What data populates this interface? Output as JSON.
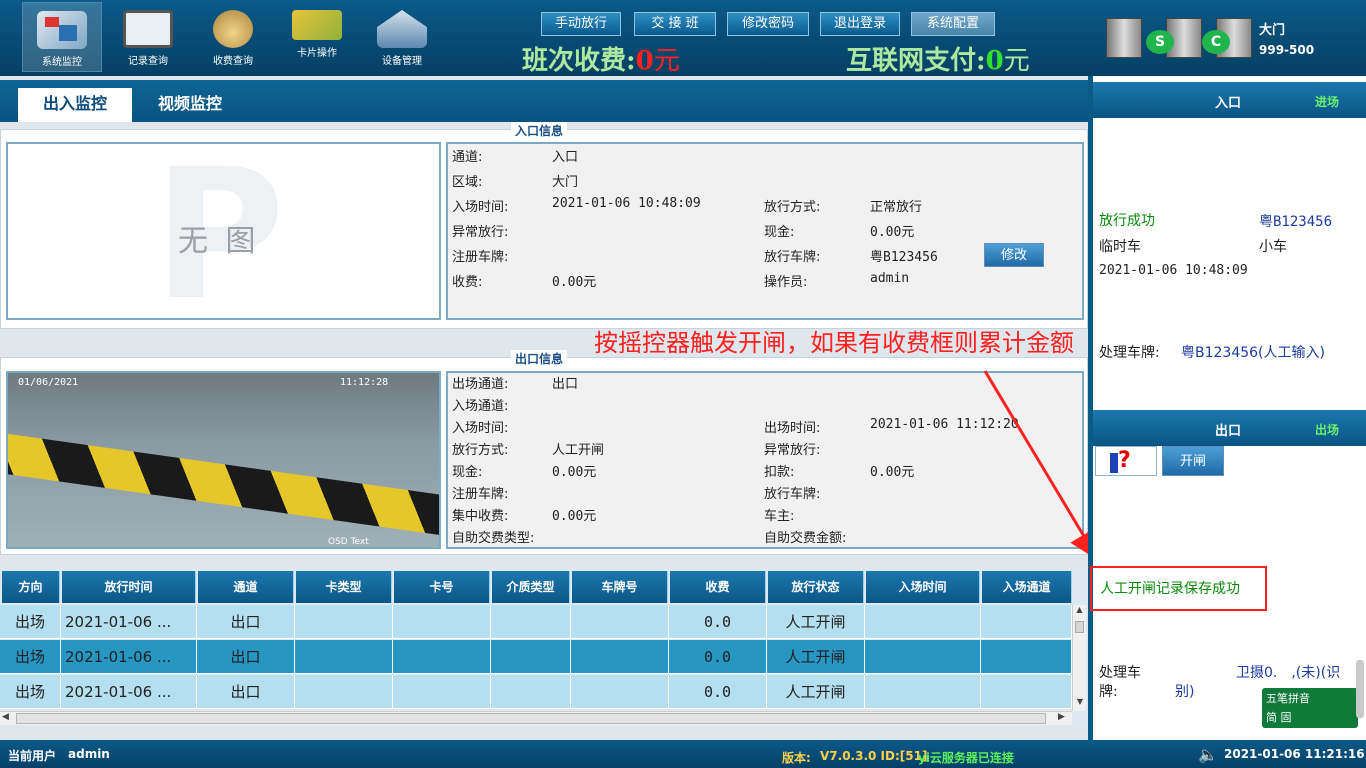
{
  "nav": [
    {
      "label": "系统监控",
      "active": true
    },
    {
      "label": "记录查询"
    },
    {
      "label": "收费查询"
    },
    {
      "label": "卡片操作"
    },
    {
      "label": "设备管理"
    }
  ],
  "top_buttons": [
    "手动放行",
    "交 接 班",
    "修改密码",
    "退出登录",
    "系统配置"
  ],
  "fee": {
    "shift_label": "班次收费:",
    "shift_value": "0",
    "shift_unit": "元",
    "net_label": "互联网支付:",
    "net_value": "0",
    "net_unit": "元"
  },
  "station": {
    "name": "大门",
    "code": "999-500"
  },
  "tabs": [
    "出入监控",
    "视频监控"
  ],
  "entry": {
    "section_title": "入口信息",
    "no_image": "无 图",
    "channel_label": "通道:",
    "channel": "入口",
    "area_label": "区域:",
    "area": "大门",
    "time_label": "入场时间:",
    "time": "2021-01-06 10:48:09",
    "release_mode_label": "放行方式:",
    "release_mode": "正常放行",
    "abnormal_label": "异常放行:",
    "cash_label": "现金:",
    "cash": "0.00元",
    "reg_plate_label": "注册车牌:",
    "release_plate_label": "放行车牌:",
    "release_plate": "粤B123456",
    "modify_button": "修改",
    "fee_label": "收费:",
    "fee": "0.00元",
    "operator_label": "操作员:",
    "operator": "admin"
  },
  "exit": {
    "section_title": "出口信息",
    "cam_date": "01/06/2021",
    "cam_time": "11:12:28",
    "cam_osd": "OSD Text",
    "out_channel_label": "出场通道:",
    "out_channel": "出口",
    "in_channel_label": "入场通道:",
    "in_time_label": "入场时间:",
    "out_time_label": "出场时间:",
    "out_time": "2021-01-06 11:12:20",
    "release_mode_label": "放行方式:",
    "release_mode": "人工开闸",
    "abnormal_label": "异常放行:",
    "cash_label": "现金:",
    "cash": "0.00元",
    "deduct_label": "扣款:",
    "deduct": "0.00元",
    "reg_plate_label": "注册车牌:",
    "release_plate_label": "放行车牌:",
    "central_fee_label": "集中收费:",
    "central_fee": "0.00元",
    "owner_label": "车主:",
    "self_type_label": "自助交费类型:",
    "self_amount_label": "自助交费金额:"
  },
  "annotation": "按摇控器触发开闸，如果有收费框则累计金额",
  "table": {
    "headers": [
      "方向",
      "放行时间",
      "通道",
      "卡类型",
      "卡号",
      "介质类型",
      "车牌号",
      "收费",
      "放行状态",
      "入场时间",
      "入场通道"
    ],
    "rows": [
      [
        "出场",
        "2021-01-06 ...",
        "出口",
        "",
        "",
        "",
        "",
        "0.0",
        "人工开闸",
        "",
        ""
      ],
      [
        "出场",
        "2021-01-06 ...",
        "出口",
        "",
        "",
        "",
        "",
        "0.0",
        "人工开闸",
        "",
        ""
      ],
      [
        "出场",
        "2021-01-06 ...",
        "出口",
        "",
        "",
        "",
        "",
        "0.0",
        "人工开闸",
        "",
        ""
      ]
    ]
  },
  "right_entry": {
    "title": "入口",
    "tag": "进场",
    "status": "放行成功",
    "plate": "粤B123456",
    "car_type": "临时车",
    "car_size": "小车",
    "time": "2021-01-06 10:48:09",
    "processed_label": "处理车牌:",
    "processed_value": "粤B123456(人工输入)"
  },
  "right_exit": {
    "title": "出口",
    "tag": "出场",
    "open_button": "开闸",
    "message": "人工开闸记录保存成功",
    "processed_label1": "处理车",
    "processed_label2": "牌:",
    "processed_value1": "卫摄0.　,(未)(识",
    "processed_value2": "别)"
  },
  "ime": {
    "line1": "五笔拼音",
    "line2": "简 固"
  },
  "status": {
    "user_label": "当前用户",
    "user": "admin",
    "version_label": "版本:",
    "version": "V7.0.3.0 ID:[51]",
    "cloud": "yi云服务器已连接",
    "datetime": "2021-01-06 11:21:16"
  },
  "colors": {
    "header": "#0a5a88",
    "accent_green": "#aee8a0",
    "fee_red": "#ff2020",
    "row_selected": "#2896c2",
    "row_normal": "#b4dff0"
  }
}
